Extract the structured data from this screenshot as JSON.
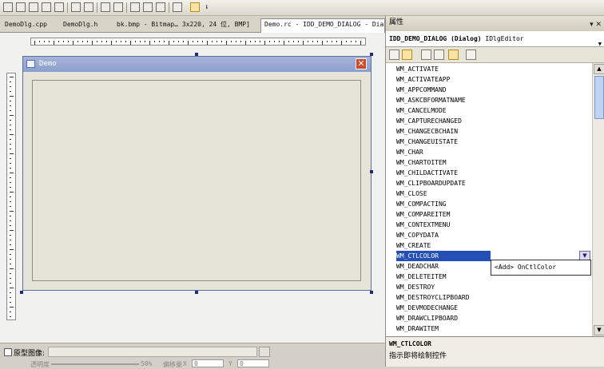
{
  "toolbar": {
    "icons": [
      "align-left-icon",
      "align-right-icon",
      "align-top-icon",
      "align-bottom-icon",
      "center-vertical-icon",
      "center-horizontal-icon",
      "space-across-icon",
      "space-down-icon",
      "make-same-width-icon",
      "make-same-height-icon",
      "make-same-size-icon",
      "size-to-content-icon",
      "toggle-grid-icon",
      "toggle-guides-icon"
    ],
    "overflow_label": "⇂"
  },
  "tabs": [
    {
      "label": "DemoDlg.cpp",
      "active": false
    },
    {
      "label": "DemoDlg.h",
      "active": false
    },
    {
      "label": "bk.bmp - Bitmap… 3x220, 24 位, BMP]",
      "active": false
    },
    {
      "label": "Demo.rc - IDD_DEMO_DIALOG - Dial",
      "active": true
    }
  ],
  "dialog": {
    "title": "Demo",
    "close_label": "✕"
  },
  "bottom": {
    "prototype_label": "原型图像:",
    "prototype_path": "",
    "transparency_label": "透明度",
    "transparency_value": "50%",
    "offset_label": "偏移量",
    "offset_x_label": "X",
    "offset_x": "0",
    "offset_y_label": "Y",
    "offset_y": "0"
  },
  "properties": {
    "title": "属性",
    "controls": "▾ ✕",
    "object_name": "IDD_DEMO_DIALOG (Dialog)",
    "object_type": " IDlgEditor",
    "dropdown_icon": "▼",
    "toolbar_icons": [
      "categorized-icon",
      "alphabetical-icon",
      "properties-icon",
      "events-icon",
      "messages-icon",
      "overrides-icon",
      "property-pages-icon"
    ],
    "messages": [
      "WM_ACTIVATE",
      "WM_ACTIVATEAPP",
      "WM_APPCOMMAND",
      "WM_ASKCBFORMATNAME",
      "WM_CANCELMODE",
      "WM_CAPTURECHANGED",
      "WM_CHANGECBCHAIN",
      "WM_CHANGEUISTATE",
      "WM_CHAR",
      "WM_CHARTOITEM",
      "WM_CHILDACTIVATE",
      "WM_CLIPBOARDUPDATE",
      "WM_CLOSE",
      "WM_COMPACTING",
      "WM_COMPAREITEM",
      "WM_CONTEXTMENU",
      "WM_COPYDATA",
      "WM_CREATE",
      "WM_CTLCOLOR",
      "WM_DEADCHAR",
      "WM_DELETEITEM",
      "WM_DESTROY",
      "WM_DESTROYCLIPBOARD",
      "WM_DEVMODECHANGE",
      "WM_DRAWCLIPBOARD",
      "WM_DRAWITEM"
    ],
    "selected_index": 18,
    "handler_option": "<Add> OnCtlColor",
    "description_title": "WM_CTLCOLOR",
    "description_text": "指示即将绘制控件",
    "scroll_up": "▲",
    "scroll_down": "▼",
    "handler_arrow": "▼"
  }
}
